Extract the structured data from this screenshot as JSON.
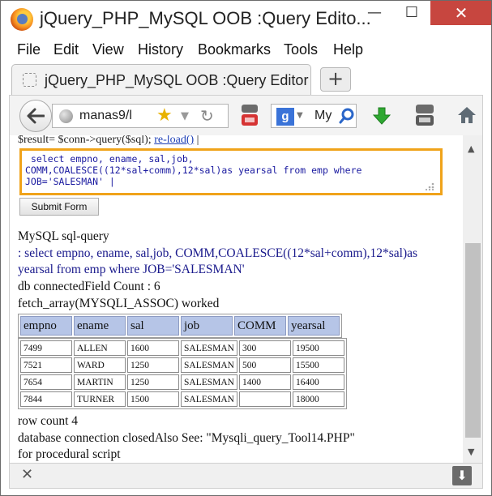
{
  "window": {
    "title": "jQuery_PHP_MySQL OOB :Query Edito...",
    "minimize": "—",
    "maximize": "☐",
    "close": "✕"
  },
  "menu": {
    "items": [
      "File",
      "Edit",
      "View",
      "History",
      "Bookmarks",
      "Tools",
      "Help"
    ]
  },
  "tabs": [
    {
      "title": "jQuery_PHP_MySQL OOB :Query Editor"
    }
  ],
  "newtab_label": "+",
  "navbar": {
    "url": "manas9/l",
    "search_text": "My",
    "search_engine_letter": "g"
  },
  "page": {
    "code_line": "$result= $conn->query($sql);",
    "reload_link": "re-load()",
    "code_tail": " |",
    "query_text": " select empno, ename, sal,job,\nCOMM,COALESCE((12*sal+comm),12*sal)as yearsal from emp where\nJOB='SALESMAN' |",
    "submit_label": "Submit Form",
    "label_sql_query": "MySQL sql-query",
    "query_echo_line1": ": select empno, ename, sal,job, COMM,COALESCE((12*sal+comm),12*sal)as",
    "query_echo_line2": "yearsal from emp where JOB='SALESMAN'",
    "db_connected": "db connectedField Count : 6",
    "fetch_status": "fetch_array(MYSQLI_ASSOC) worked",
    "row_count": "row count 4",
    "closed_line": "database connection closedAlso See: \"Mysqli_query_Tool14.PHP\"",
    "procedural_line": "for procedural script"
  },
  "table": {
    "columns": [
      "empno",
      "ename",
      "sal",
      "job",
      "COMM",
      "yearsal"
    ],
    "rows": [
      [
        "7499",
        "ALLEN",
        "1600",
        "SALESMAN",
        "300",
        "19500"
      ],
      [
        "7521",
        "WARD",
        "1250",
        "SALESMAN",
        "500",
        "15500"
      ],
      [
        "7654",
        "MARTIN",
        "1250",
        "SALESMAN",
        "1400",
        "16400"
      ],
      [
        "7844",
        "TURNER",
        "1500",
        "SALESMAN",
        "",
        "18000"
      ]
    ]
  },
  "colors": {
    "accent_border": "#f0a31a",
    "header_cell": "#b6c5e7",
    "link": "#1b3db5",
    "close_button": "#c7463f"
  },
  "icons": {
    "back": "back-arrow-icon",
    "site": "globe-icon",
    "bookmark": "star-icon",
    "reload": "reload-icon",
    "search": "magnifier-icon",
    "download": "download-arrow-icon",
    "home": "home-icon",
    "close_findbar": "close-icon",
    "save": "download-box-icon"
  }
}
